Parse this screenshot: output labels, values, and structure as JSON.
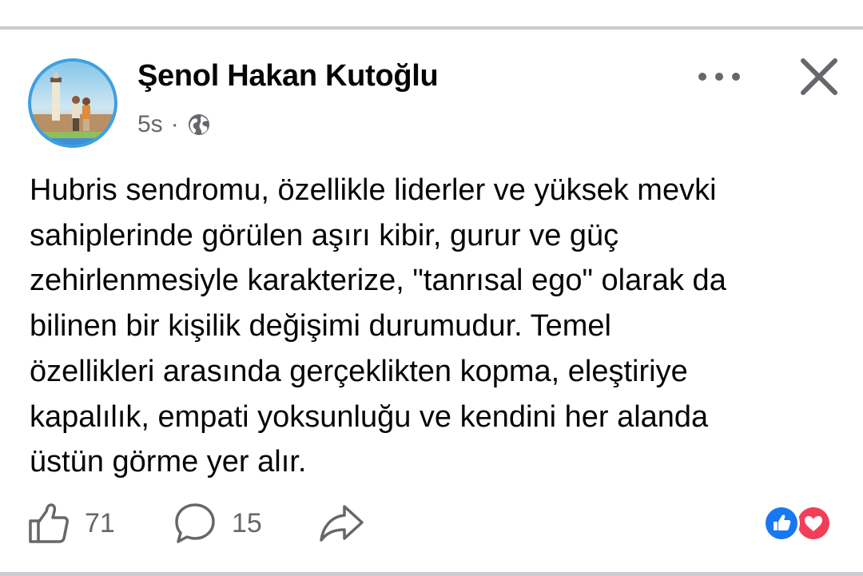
{
  "post": {
    "author": "Şenol Hakan Kutoğlu",
    "timestamp": "5s",
    "separator": "·",
    "audience_icon": "globe-icon",
    "text": "Hubris sendromu, özellikle liderler ve yüksek mevki\nsahiplerinde görülen aşırı kibir, gurur ve güç\nzehirlenmesiyle karakterize, \"tanrısal ego\" olarak da\nbilinen bir kişilik değişimi durumudur. Temel\nözellikleri arasında gerçeklikten kopma, eleştiriye\nkapalılık, empati yoksunluğu ve kendini her alanda\nüstün görme yer alır."
  },
  "header": {
    "more_icon": "more-dots-icon",
    "close_icon": "close-icon"
  },
  "actions": {
    "like_count": "71",
    "comment_count": "15",
    "share_icon": "share-icon"
  },
  "reactions": [
    "like",
    "love"
  ],
  "colors": {
    "text": "#050505",
    "secondary": "#65676b",
    "like_blue": "#1877f2",
    "love_red": "#f33e58",
    "divider": "#c9ccd1"
  }
}
